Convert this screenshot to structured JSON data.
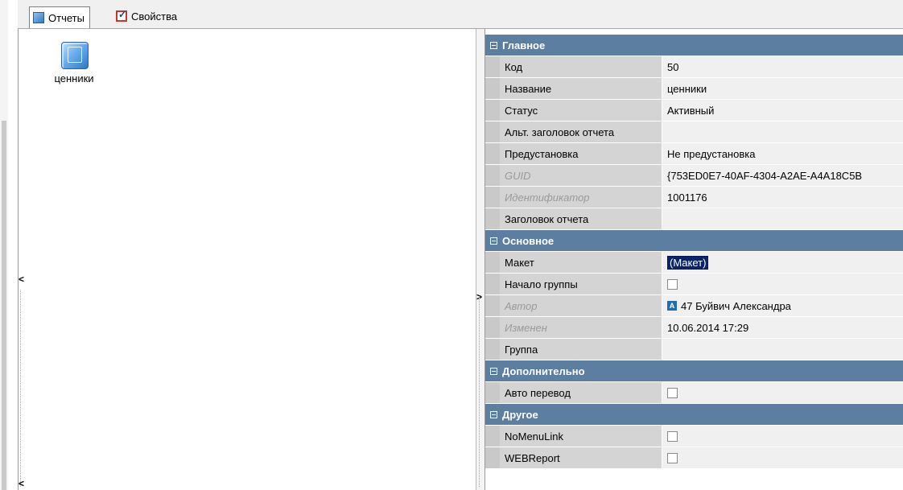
{
  "tabs": [
    {
      "label": "Отчеты",
      "icon": "cube-icon",
      "active": true
    },
    {
      "label": "Свойства",
      "icon": "checkbox-icon",
      "active": false
    }
  ],
  "report_item": {
    "label": "ценники",
    "icon": "report-cube-icon"
  },
  "properties": {
    "main": {
      "title": "Главное",
      "rows": [
        {
          "name": "Код",
          "value": "50"
        },
        {
          "name": "Название",
          "value": "ценники"
        },
        {
          "name": "Статус",
          "value": "Активный"
        },
        {
          "name": "Альт. заголовок отчета",
          "value": ""
        },
        {
          "name": "Предустановка",
          "value": "Не предустановка"
        },
        {
          "name": "GUID",
          "value": "{753ED0E7-40AF-4304-A2AE-A4A18C5B"
        },
        {
          "name": "Идентификатор",
          "value": "1001176"
        },
        {
          "name": "Заголовок отчета",
          "value": ""
        }
      ]
    },
    "basic": {
      "title": "Основное",
      "rows": [
        {
          "name": "Макет",
          "value": "(Макет)"
        },
        {
          "name": "Начало группы",
          "value": ""
        },
        {
          "name": "Автор",
          "value": "47 Буйвич Александра",
          "badge": "A"
        },
        {
          "name": "Изменен",
          "value": "10.06.2014 17:29"
        },
        {
          "name": "Группа",
          "value": ""
        }
      ]
    },
    "extra": {
      "title": "Дополнительно",
      "rows": [
        {
          "name": "Авто перевод",
          "value": ""
        }
      ]
    },
    "other": {
      "title": "Другое",
      "rows": [
        {
          "name": "NoMenuLink",
          "value": ""
        },
        {
          "name": "WEBReport",
          "value": ""
        }
      ]
    }
  },
  "colors": {
    "category_bg": "#5c7ea0",
    "name_bg": "#d4d4d4",
    "value_bg": "#f0f0f0",
    "selection": "#0a246a"
  }
}
